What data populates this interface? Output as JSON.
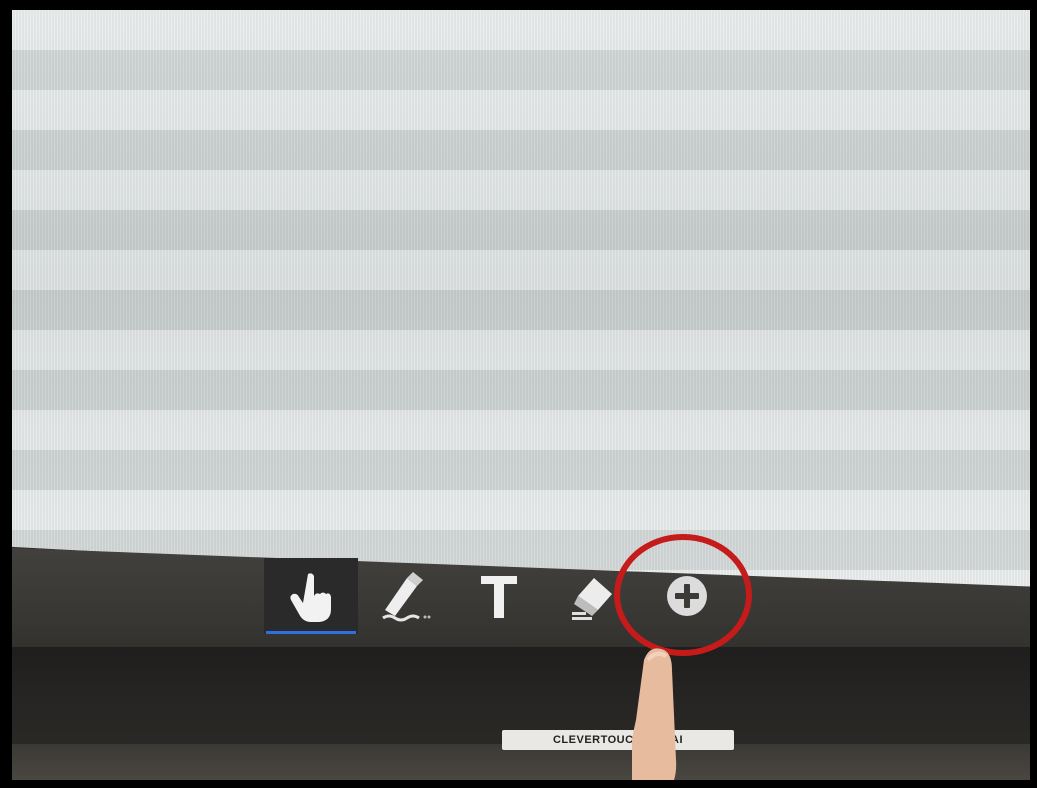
{
  "toolbar": {
    "tools": [
      {
        "name": "touch",
        "icon": "hand-pointer-icon",
        "active": true
      },
      {
        "name": "pen",
        "icon": "pen-icon",
        "active": false
      },
      {
        "name": "text",
        "icon": "text-icon",
        "active": false
      },
      {
        "name": "eraser",
        "icon": "eraser-icon",
        "active": false
      },
      {
        "name": "add",
        "icon": "plus-circle-icon",
        "active": false
      }
    ],
    "active_indicator_color": "#2f6fe0"
  },
  "device_label": "CLEVERTOUCH JA    LAI",
  "annotation": {
    "color": "#c51b1b",
    "target": "add-tool-button"
  }
}
